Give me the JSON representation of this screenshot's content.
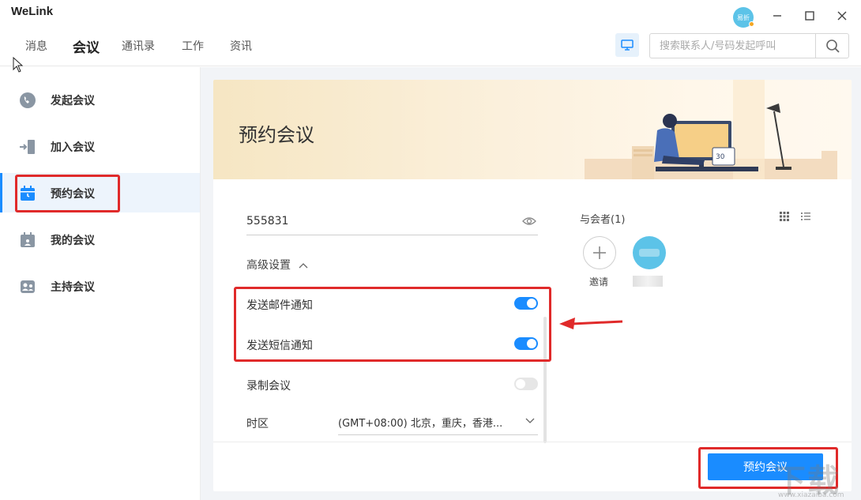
{
  "app": {
    "title": "WeLink",
    "avatar_text": "易折"
  },
  "window": {
    "minimize": "—",
    "maximize": "☐",
    "close": "✕"
  },
  "nav": {
    "tabs": [
      {
        "label": "消息"
      },
      {
        "label": "会议",
        "active": true
      },
      {
        "label": "通讯录"
      },
      {
        "label": "工作"
      },
      {
        "label": "资讯"
      }
    ],
    "search_placeholder": "搜索联系人/号码发起呼叫"
  },
  "sidebar": {
    "items": [
      {
        "label": "发起会议",
        "icon": "phone-icon"
      },
      {
        "label": "加入会议",
        "icon": "join-icon"
      },
      {
        "label": "预约会议",
        "icon": "calendar-icon",
        "active": true
      },
      {
        "label": "我的会议",
        "icon": "my-meeting-icon"
      },
      {
        "label": "主持会议",
        "icon": "host-icon"
      }
    ]
  },
  "main": {
    "banner_title": "预约会议",
    "password_value": "555831",
    "advanced_label": "高级设置",
    "toggles": [
      {
        "label": "发送邮件通知",
        "on": true
      },
      {
        "label": "发送短信通知",
        "on": true
      },
      {
        "label": "录制会议",
        "on": false
      }
    ],
    "timezone_label": "时区",
    "timezone_value": "(GMT+08:00) 北京，重庆，香港...",
    "participants_title": "与会者(1)",
    "invite_label": "邀请",
    "submit_label": "预约会议"
  },
  "colors": {
    "accent": "#1a8cff",
    "highlight_box": "#e02a2a"
  },
  "watermark": {
    "text": "下载",
    "url": "www.xiazaiba.com"
  }
}
